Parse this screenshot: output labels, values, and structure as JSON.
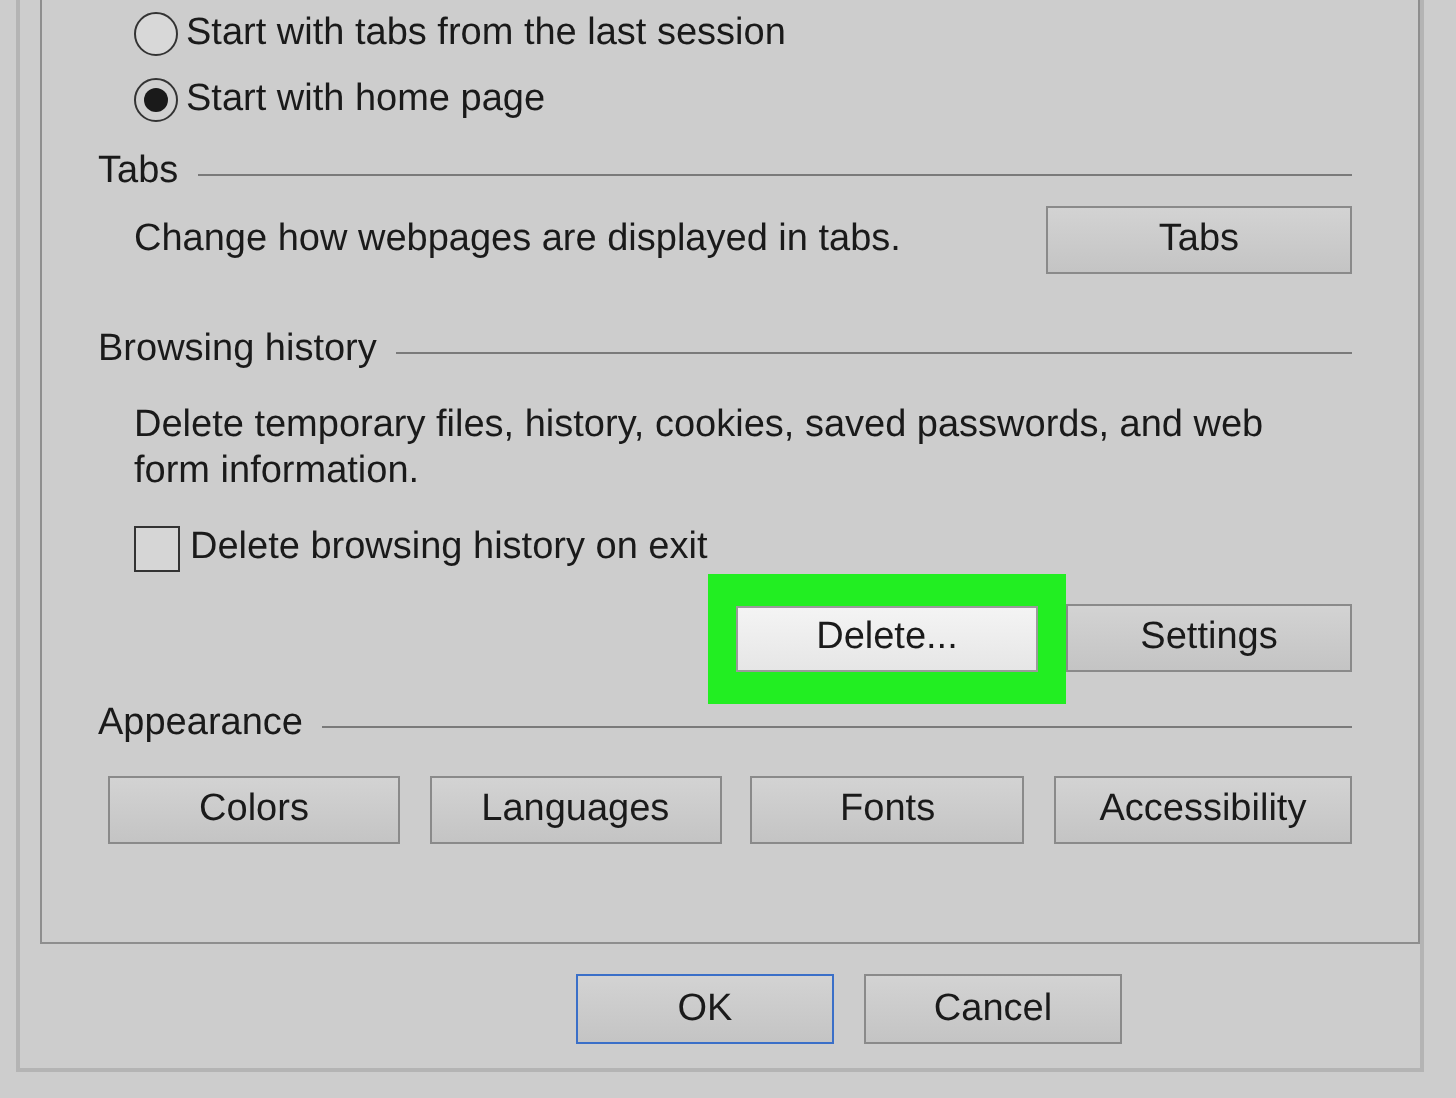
{
  "startup_options": [
    {
      "label": "Start with tabs from the last session",
      "selected": false
    },
    {
      "label": "Start with home page",
      "selected": true
    }
  ],
  "tabs_section": {
    "title": "Tabs",
    "description": "Change how webpages are displayed in tabs.",
    "button": "Tabs"
  },
  "browsing_history": {
    "title": "Browsing history",
    "description": "Delete temporary files, history, cookies, saved passwords, and web form information.",
    "checkbox": {
      "label": "Delete browsing history on exit",
      "checked": false
    },
    "buttons": [
      {
        "label": "Delete...",
        "highlighted": true
      },
      {
        "label": "Settings",
        "highlighted": false
      }
    ]
  },
  "appearance": {
    "title": "Appearance",
    "buttons": [
      {
        "label": "Colors"
      },
      {
        "label": "Languages"
      },
      {
        "label": "Fonts"
      },
      {
        "label": "Accessibility"
      }
    ]
  },
  "dialog_buttons": [
    {
      "label": "OK",
      "default": true
    },
    {
      "label": "Cancel",
      "default": false
    }
  ]
}
